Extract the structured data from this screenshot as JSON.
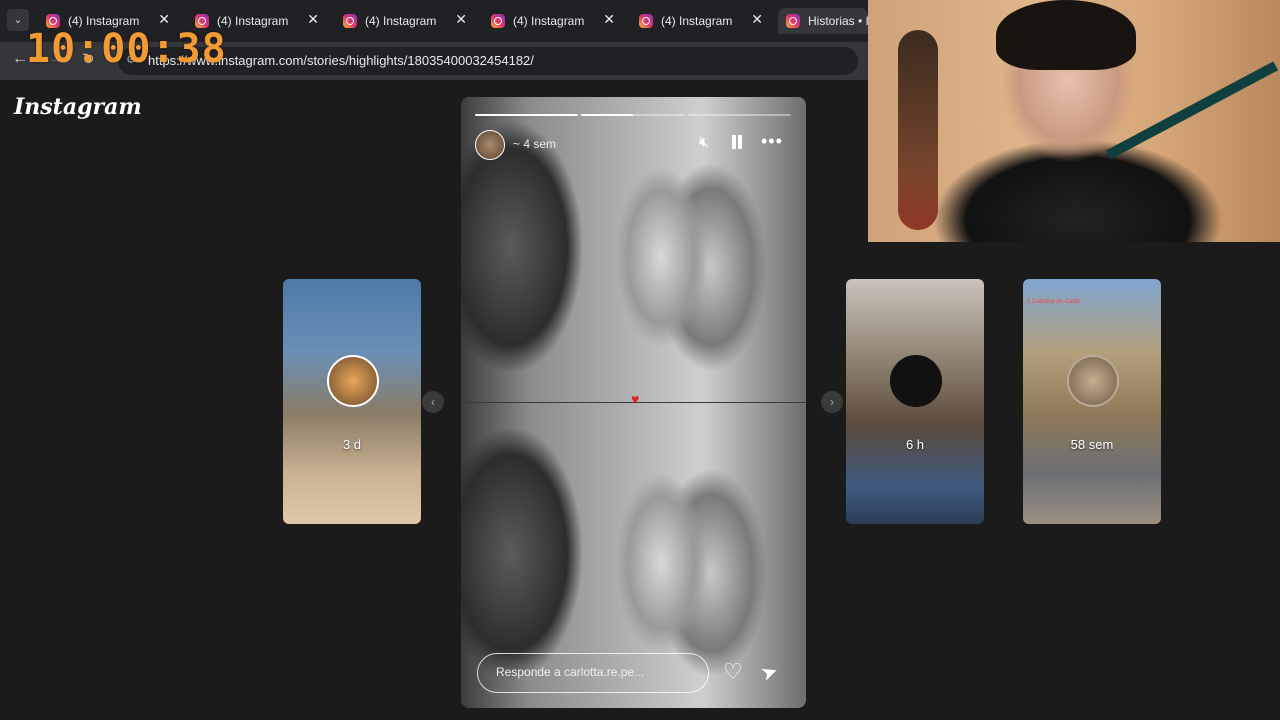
{
  "browser": {
    "tabs": [
      {
        "title": "(4) Instagram"
      },
      {
        "title": "(4) Instagram"
      },
      {
        "title": "(4) Instagram"
      },
      {
        "title": "(4) Instagram"
      },
      {
        "title": "(4) Instagram"
      },
      {
        "title": "Historias • I"
      }
    ],
    "url": "https://www.instagram.com/stories/highlights/18035400032454182/"
  },
  "overlay_clock": "10:00:38",
  "instagram": {
    "logo": "Instagram",
    "story": {
      "time_ago": "~ 4 sem",
      "reply_placeholder": "Responde a carlotta.re.pe...",
      "progress_segments": [
        1.0,
        0.5,
        0.0
      ]
    },
    "thumbnails": [
      {
        "label": "3 d",
        "tag": ""
      },
      {
        "label": "6 h",
        "tag": ""
      },
      {
        "label": "58 sem",
        "tag": "1 Catedral de Cádiz"
      }
    ]
  },
  "icons": {
    "mute": "speaker-muted-icon",
    "pause": "pause-icon",
    "more": "more-options-icon",
    "like": "heart-icon",
    "send": "send-icon"
  },
  "colors": {
    "clock": "#f39a34",
    "background": "#1b1b1b",
    "heart_sticker": "#e02424"
  }
}
